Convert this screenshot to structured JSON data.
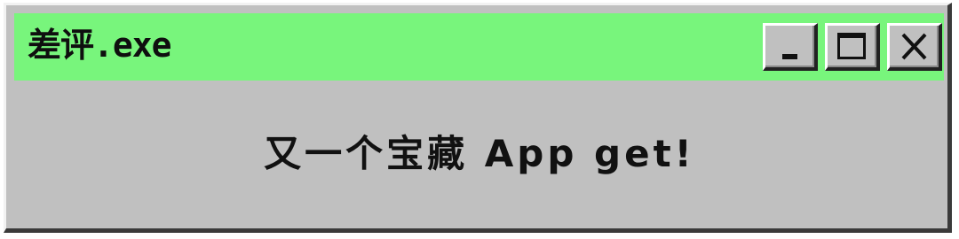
{
  "window": {
    "title": "差评.exe",
    "titlebar_color": "#78f57c",
    "body_color": "#c0c0c0"
  },
  "controls": {
    "minimize_icon": "minimize-icon",
    "maximize_icon": "maximize-icon",
    "close_icon": "close-icon"
  },
  "content": {
    "message": "又一个宝藏 App get!"
  }
}
